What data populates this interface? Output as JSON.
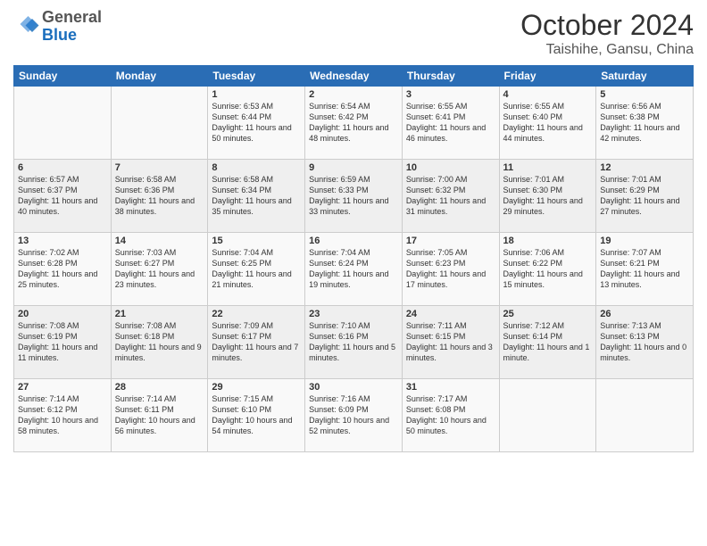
{
  "header": {
    "logo_general": "General",
    "logo_blue": "Blue",
    "month": "October 2024",
    "location": "Taishihe, Gansu, China"
  },
  "days_of_week": [
    "Sunday",
    "Monday",
    "Tuesday",
    "Wednesday",
    "Thursday",
    "Friday",
    "Saturday"
  ],
  "weeks": [
    [
      {
        "day": "",
        "info": ""
      },
      {
        "day": "",
        "info": ""
      },
      {
        "day": "1",
        "info": "Sunrise: 6:53 AM\nSunset: 6:44 PM\nDaylight: 11 hours and 50 minutes."
      },
      {
        "day": "2",
        "info": "Sunrise: 6:54 AM\nSunset: 6:42 PM\nDaylight: 11 hours and 48 minutes."
      },
      {
        "day": "3",
        "info": "Sunrise: 6:55 AM\nSunset: 6:41 PM\nDaylight: 11 hours and 46 minutes."
      },
      {
        "day": "4",
        "info": "Sunrise: 6:55 AM\nSunset: 6:40 PM\nDaylight: 11 hours and 44 minutes."
      },
      {
        "day": "5",
        "info": "Sunrise: 6:56 AM\nSunset: 6:38 PM\nDaylight: 11 hours and 42 minutes."
      }
    ],
    [
      {
        "day": "6",
        "info": "Sunrise: 6:57 AM\nSunset: 6:37 PM\nDaylight: 11 hours and 40 minutes."
      },
      {
        "day": "7",
        "info": "Sunrise: 6:58 AM\nSunset: 6:36 PM\nDaylight: 11 hours and 38 minutes."
      },
      {
        "day": "8",
        "info": "Sunrise: 6:58 AM\nSunset: 6:34 PM\nDaylight: 11 hours and 35 minutes."
      },
      {
        "day": "9",
        "info": "Sunrise: 6:59 AM\nSunset: 6:33 PM\nDaylight: 11 hours and 33 minutes."
      },
      {
        "day": "10",
        "info": "Sunrise: 7:00 AM\nSunset: 6:32 PM\nDaylight: 11 hours and 31 minutes."
      },
      {
        "day": "11",
        "info": "Sunrise: 7:01 AM\nSunset: 6:30 PM\nDaylight: 11 hours and 29 minutes."
      },
      {
        "day": "12",
        "info": "Sunrise: 7:01 AM\nSunset: 6:29 PM\nDaylight: 11 hours and 27 minutes."
      }
    ],
    [
      {
        "day": "13",
        "info": "Sunrise: 7:02 AM\nSunset: 6:28 PM\nDaylight: 11 hours and 25 minutes."
      },
      {
        "day": "14",
        "info": "Sunrise: 7:03 AM\nSunset: 6:27 PM\nDaylight: 11 hours and 23 minutes."
      },
      {
        "day": "15",
        "info": "Sunrise: 7:04 AM\nSunset: 6:25 PM\nDaylight: 11 hours and 21 minutes."
      },
      {
        "day": "16",
        "info": "Sunrise: 7:04 AM\nSunset: 6:24 PM\nDaylight: 11 hours and 19 minutes."
      },
      {
        "day": "17",
        "info": "Sunrise: 7:05 AM\nSunset: 6:23 PM\nDaylight: 11 hours and 17 minutes."
      },
      {
        "day": "18",
        "info": "Sunrise: 7:06 AM\nSunset: 6:22 PM\nDaylight: 11 hours and 15 minutes."
      },
      {
        "day": "19",
        "info": "Sunrise: 7:07 AM\nSunset: 6:21 PM\nDaylight: 11 hours and 13 minutes."
      }
    ],
    [
      {
        "day": "20",
        "info": "Sunrise: 7:08 AM\nSunset: 6:19 PM\nDaylight: 11 hours and 11 minutes."
      },
      {
        "day": "21",
        "info": "Sunrise: 7:08 AM\nSunset: 6:18 PM\nDaylight: 11 hours and 9 minutes."
      },
      {
        "day": "22",
        "info": "Sunrise: 7:09 AM\nSunset: 6:17 PM\nDaylight: 11 hours and 7 minutes."
      },
      {
        "day": "23",
        "info": "Sunrise: 7:10 AM\nSunset: 6:16 PM\nDaylight: 11 hours and 5 minutes."
      },
      {
        "day": "24",
        "info": "Sunrise: 7:11 AM\nSunset: 6:15 PM\nDaylight: 11 hours and 3 minutes."
      },
      {
        "day": "25",
        "info": "Sunrise: 7:12 AM\nSunset: 6:14 PM\nDaylight: 11 hours and 1 minute."
      },
      {
        "day": "26",
        "info": "Sunrise: 7:13 AM\nSunset: 6:13 PM\nDaylight: 11 hours and 0 minutes."
      }
    ],
    [
      {
        "day": "27",
        "info": "Sunrise: 7:14 AM\nSunset: 6:12 PM\nDaylight: 10 hours and 58 minutes."
      },
      {
        "day": "28",
        "info": "Sunrise: 7:14 AM\nSunset: 6:11 PM\nDaylight: 10 hours and 56 minutes."
      },
      {
        "day": "29",
        "info": "Sunrise: 7:15 AM\nSunset: 6:10 PM\nDaylight: 10 hours and 54 minutes."
      },
      {
        "day": "30",
        "info": "Sunrise: 7:16 AM\nSunset: 6:09 PM\nDaylight: 10 hours and 52 minutes."
      },
      {
        "day": "31",
        "info": "Sunrise: 7:17 AM\nSunset: 6:08 PM\nDaylight: 10 hours and 50 minutes."
      },
      {
        "day": "",
        "info": ""
      },
      {
        "day": "",
        "info": ""
      }
    ]
  ]
}
